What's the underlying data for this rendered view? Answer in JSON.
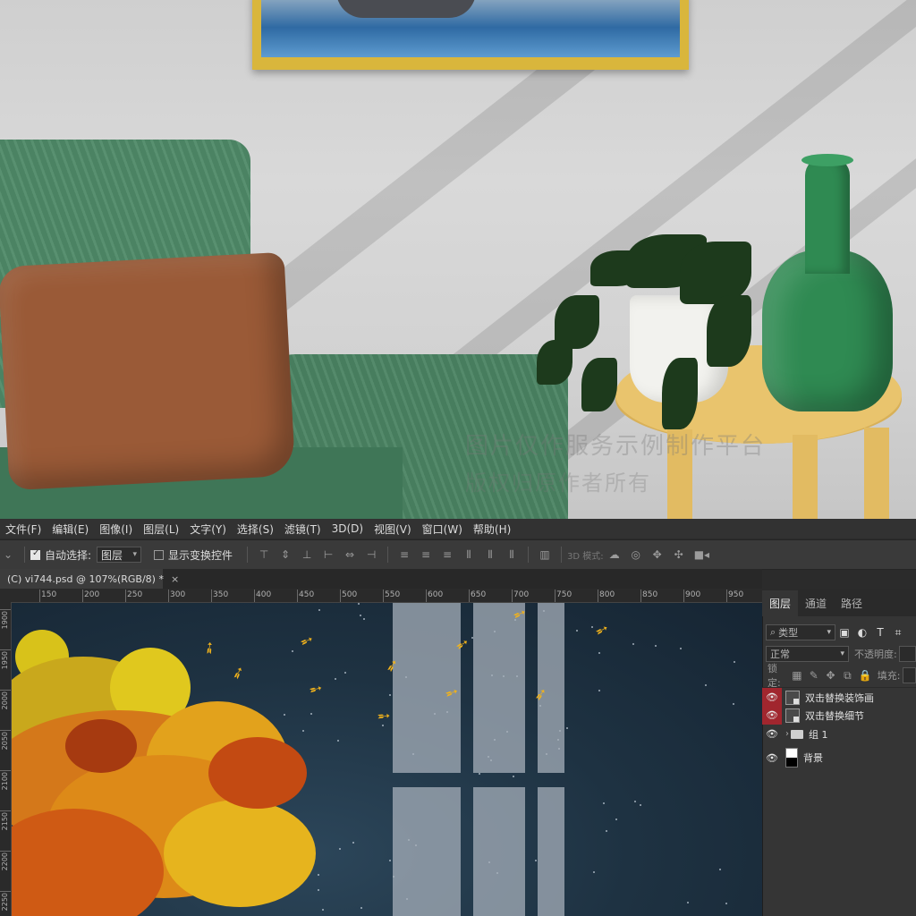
{
  "menu": {
    "items": [
      "文件(F)",
      "编辑(E)",
      "图像(I)",
      "图层(L)",
      "文字(Y)",
      "选择(S)",
      "滤镜(T)",
      "3D(D)",
      "视图(V)",
      "窗口(W)",
      "帮助(H)"
    ]
  },
  "options_bar": {
    "auto_select_label": "自动选择:",
    "auto_select_checked": true,
    "auto_select_target": "图层",
    "show_transform_label": "显示变换控件",
    "show_transform_checked": false,
    "mode_3d_label": "3D 模式:"
  },
  "document_tab": {
    "title": "(C) vi744.psd @ 107%(RGB/8) *",
    "close": "×"
  },
  "ruler": {
    "h_labels": [
      "150",
      "200",
      "250",
      "300",
      "350",
      "400",
      "450",
      "500",
      "550",
      "600",
      "650",
      "700",
      "750",
      "800",
      "850",
      "900",
      "950"
    ],
    "v_labels": [
      "1900",
      "1950",
      "2000",
      "2050",
      "2100",
      "2150",
      "2200",
      "2250"
    ]
  },
  "layers_panel": {
    "tabs": [
      "图层",
      "通道",
      "路径"
    ],
    "active_tab": "图层",
    "filter_kind": "类型",
    "blend_mode": "正常",
    "opacity_label": "不透明度:",
    "lock_label": "锁定:",
    "fill_label": "填充:",
    "layers": [
      {
        "name": "双击替换装饰画",
        "type": "smart",
        "visible": true,
        "highlight": true
      },
      {
        "name": "双击替换细节",
        "type": "smart",
        "visible": true,
        "highlight": true
      },
      {
        "name": "组 1",
        "type": "group",
        "visible": true,
        "highlight": false
      },
      {
        "name": "背景",
        "type": "background",
        "visible": true,
        "highlight": false
      }
    ]
  },
  "photo": {
    "watermark_line1": "图片仅作服务示例制作平台",
    "watermark_line2": "版权归原作者所有"
  },
  "colors": {
    "ps_dark": "#2b2b2b",
    "eye_highlight": "#a1262e",
    "canvas_night": "#1e3242",
    "bird_gold": "#f0b21c"
  }
}
